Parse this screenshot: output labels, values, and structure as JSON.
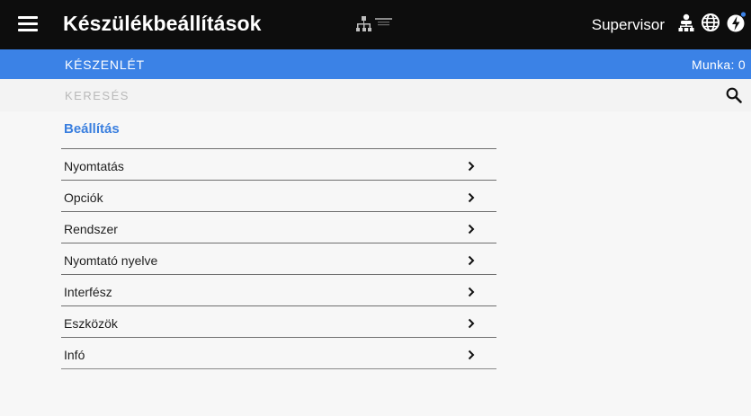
{
  "header": {
    "title": "Készülékbeállítások",
    "user_label": "Supervisor",
    "icons": [
      "menu-icon",
      "network-icon",
      "supervisor-icon",
      "globe-icon",
      "power-icon"
    ]
  },
  "status": {
    "state": "KÉSZENLÉT",
    "jobs": "Munka: 0"
  },
  "search": {
    "placeholder": "KERESÉS"
  },
  "section": {
    "title": "Beállítás"
  },
  "menu": {
    "items": [
      {
        "label": "Nyomtatás"
      },
      {
        "label": "Opciók"
      },
      {
        "label": "Rendszer"
      },
      {
        "label": "Nyomtató nyelve"
      },
      {
        "label": "Interfész"
      },
      {
        "label": "Eszközök"
      },
      {
        "label": "Infó"
      }
    ]
  },
  "colors": {
    "header_bg": "#0d0d0d",
    "status_bg": "#3b82e6",
    "accent": "#3a7fdf"
  }
}
